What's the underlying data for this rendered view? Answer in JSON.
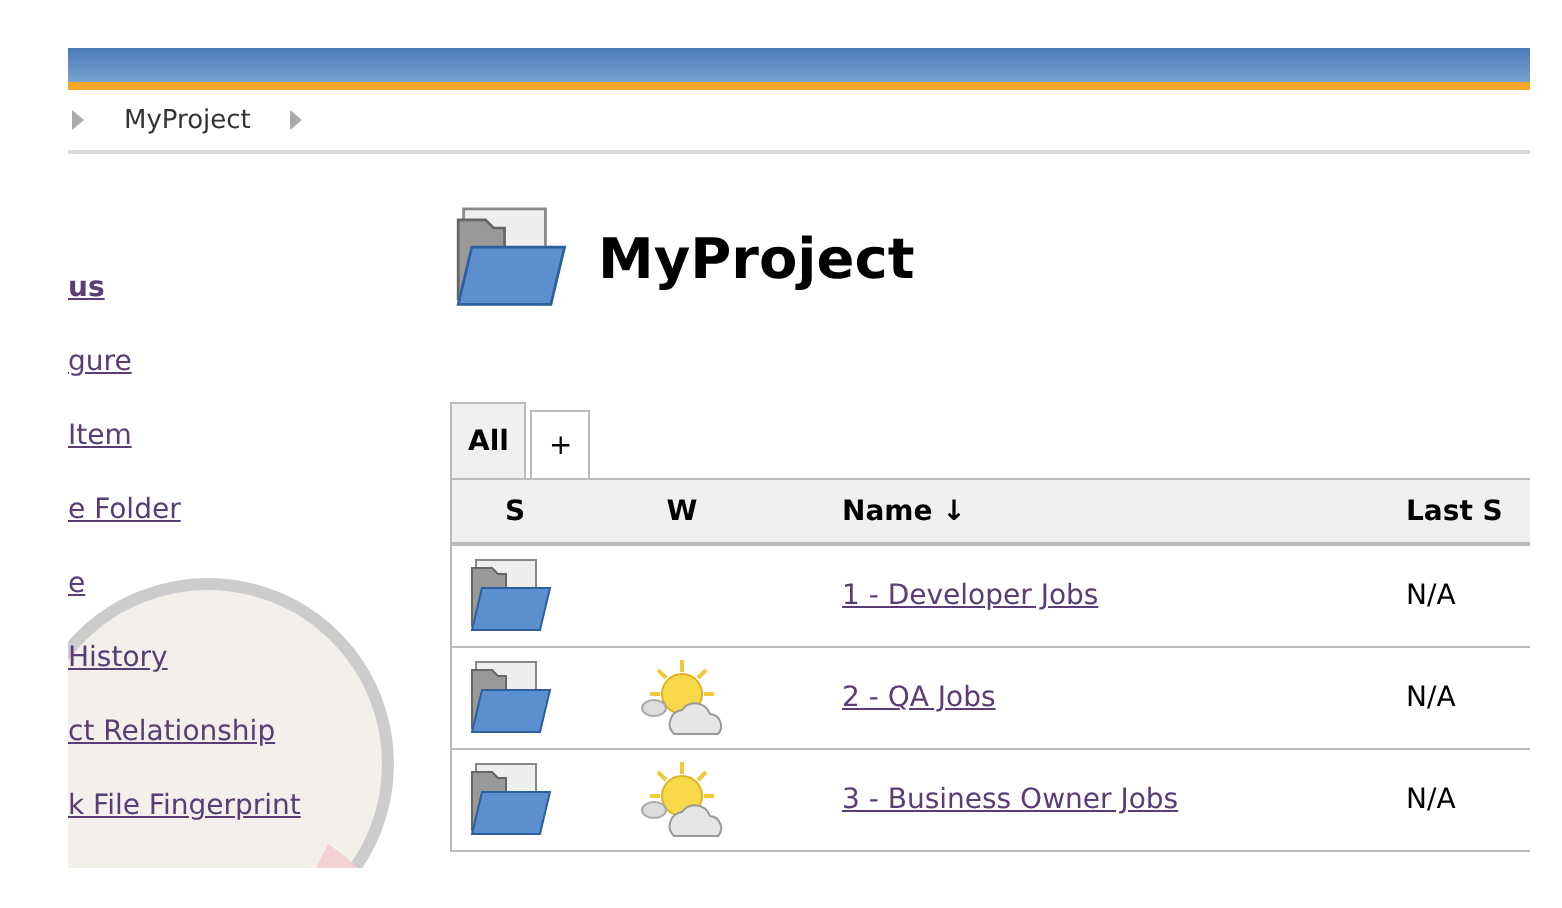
{
  "breadcrumbs": [
    "MyProject"
  ],
  "sidebar": {
    "items": [
      {
        "label": "us",
        "bold": true
      },
      {
        "label": "gure",
        "bold": false
      },
      {
        "label": "Item",
        "bold": false
      },
      {
        "label": "e Folder",
        "bold": false
      },
      {
        "label": "e",
        "bold": false
      },
      {
        "label": "History",
        "bold": false
      },
      {
        "label": "ct Relationship",
        "bold": false
      },
      {
        "label": "k File Fingerprint",
        "bold": false
      }
    ]
  },
  "page_title": "MyProject",
  "tabs": [
    {
      "label": "All",
      "selected": true
    },
    {
      "label": "+",
      "selected": false
    }
  ],
  "table": {
    "columns": [
      "S",
      "W",
      "Name ↓",
      "Last S"
    ],
    "rows": [
      {
        "s": {
          "kind": "folder"
        },
        "name": "1 - Developer Jobs",
        "last": "N/A"
      },
      {
        "s": {
          "kind": "folder"
        },
        "w": {
          "kind": "sun-cloud"
        },
        "name": "2 - QA Jobs",
        "last": "N/A"
      },
      {
        "s": {
          "kind": "folder"
        },
        "w": {
          "kind": "sun-cloud"
        },
        "name": "3 - Business Owner Jobs",
        "last": "N/A"
      }
    ]
  }
}
